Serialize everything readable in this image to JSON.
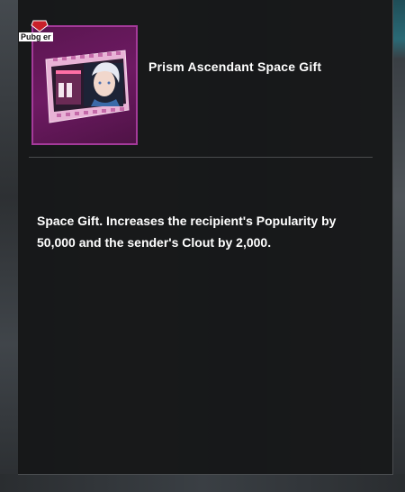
{
  "item": {
    "name": "Prism Ascendant Space Gift",
    "icon": "film-reel-portrait-icon",
    "rarity_color": "#a43a9a",
    "description": "Space Gift. Increases the recipient's Popularity by 50,000 and the sender's Clout by 2,000."
  },
  "watermark": {
    "text": "Pubg er"
  },
  "colors": {
    "panel_bg": "#161718",
    "text": "#ffffff",
    "divider": "#4a4c4e"
  }
}
